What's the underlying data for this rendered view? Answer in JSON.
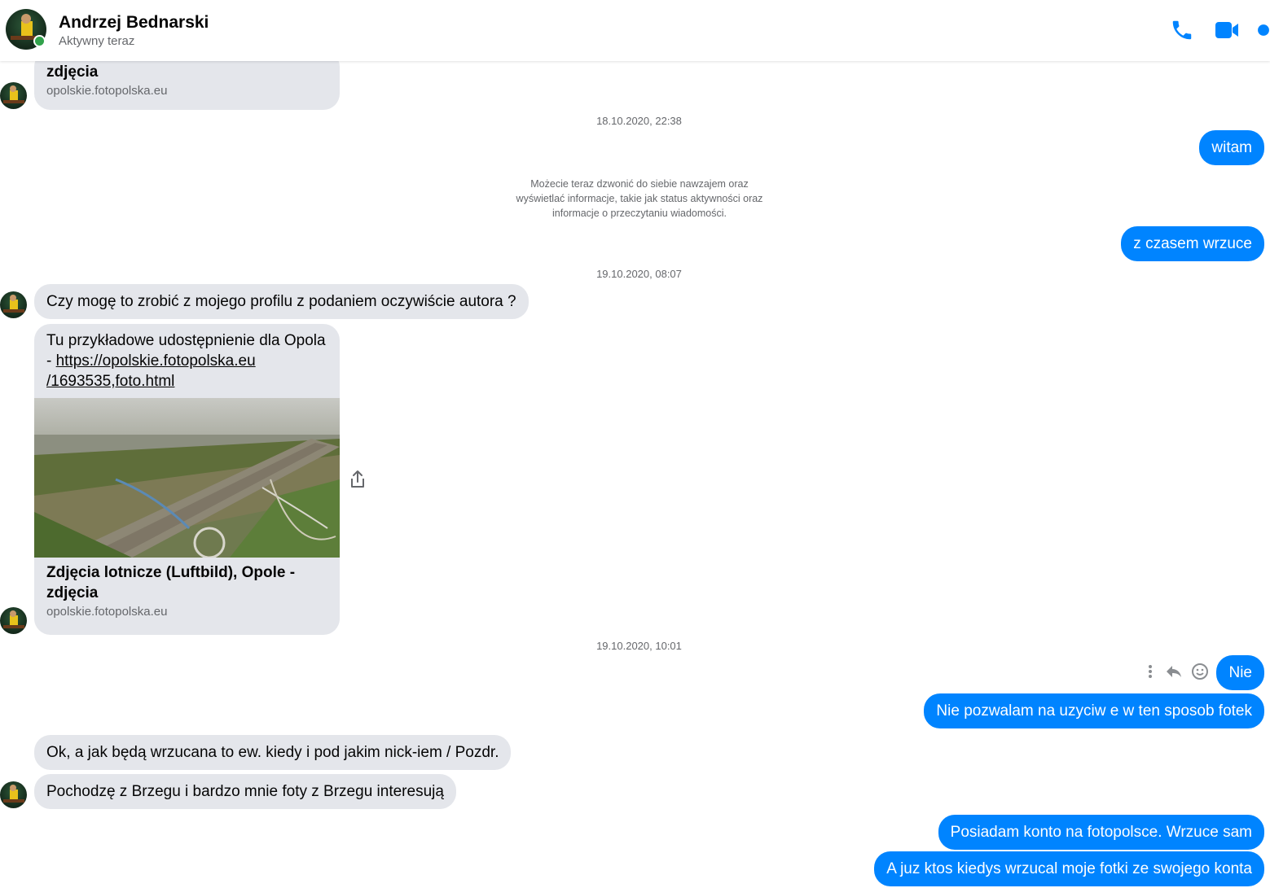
{
  "header": {
    "name": "Andrzej Bednarski",
    "status": "Aktywny teraz",
    "icons": [
      "phone-icon",
      "video-icon",
      "info-icon"
    ],
    "accent_color": "#0084ff",
    "online_color": "#31a24c"
  },
  "messages": {
    "card_top": {
      "title": "zdjęcia",
      "domain": "opolskie.fotopolska.eu"
    },
    "ts1": "18.10.2020, 22:38",
    "out1": "witam",
    "system_note": "Możecie teraz dzwonić do siebie nawzajem oraz wyświetlać informacje, takie jak status aktywności oraz informacje o przeczytaniu wiadomości.",
    "out2": "z czasem wrzuce",
    "ts2": "19.10.2020, 08:07",
    "in1": "Czy mogę to zrobić z mojego profilu z podaniem oczywiście autora ?",
    "card_main": {
      "text_prefix": "Tu przykładowe udostępnienie dla Opola",
      "dash": "- ",
      "link_line1": "https://opolskie.fotopolska.eu",
      "link_line2": "/1693535,foto.html",
      "title_line1": "Zdjęcia lotnicze (Luftbild), Opole -",
      "title_line2": "zdjęcia",
      "domain": "opolskie.fotopolska.eu"
    },
    "ts3": "19.10.2020, 10:01",
    "out3": "Nie",
    "out4": "Nie pozwalam na uzyciw e w ten sposob fotek",
    "in2": "Ok, a jak będą wrzucana to ew. kiedy i pod jakim nick-iem / Pozdr.",
    "in3": "Pochodzę z Brzegu i bardzo mnie foty z Brzegu interesują",
    "out5": "Posiadam konto na fotopolsce. Wrzuce sam",
    "out6": "A juz ktos kiedys wrzucal moje fotki ze swojego konta"
  }
}
